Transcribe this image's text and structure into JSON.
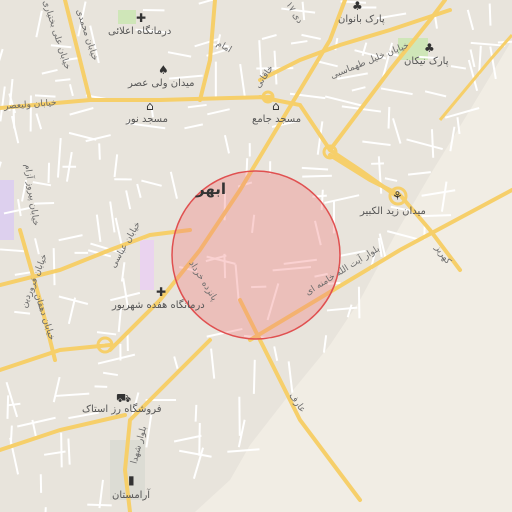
{
  "map": {
    "city_label": "ابهر",
    "poi_labels": {
      "clinic_aalaei": "درمانگاه اعلائی",
      "park_banvan": "پارک بانوان",
      "park_nikan": "پارک نیکان",
      "sq_valiasr": "میدان ولی عصر",
      "mosque_noor": "مسجد نور",
      "mosque_jame": "مسجد جامع",
      "sq_zeid": "میدان زید الکبیر",
      "clinic_17": "درمانگاه هفده شهریور",
      "store_razestak": "فروشگاه رز استاک",
      "cemetery": "آرامستان"
    },
    "street_labels": {
      "st_17dey": "۱۷ دی",
      "st_ali_bakhtiari": "خیابان علی بختیاری",
      "st_mohammadi": "خیابان محمدی",
      "st_imam": "امام",
      "st_khaqani": "خاقانی",
      "st_tahmasebi": "خیابان خلیل طهماسبی",
      "st_valiasr": "خیابان ولیعصر",
      "st_abbasi": "خیابان عباسی",
      "st_pirooz": "خیابان پیروز آزام",
      "st_farvardin": "خیابان فروردین",
      "st_dehghan": "خیابان دهقان",
      "st_15khordad": "پانزده خرداد",
      "st_khamenei": "بلوار آیت الله خامنه ای",
      "st_shohada": "بلوار شهدا",
      "st_aref": "عارف",
      "st_kahriz": "کهریز"
    },
    "icons": {
      "clinic": "medical-cross",
      "park": "tree",
      "square": "monument",
      "mosque": "mosque",
      "store": "shopping-cart",
      "cemetery": "cemetery"
    },
    "colors": {
      "background": "#f1ede4",
      "major_road": "#f6cf6a",
      "minor_road": "#ffffff",
      "green": "#cfe6b8",
      "selection_fill": "#f07a7a",
      "selection_stroke": "#e05050"
    }
  }
}
